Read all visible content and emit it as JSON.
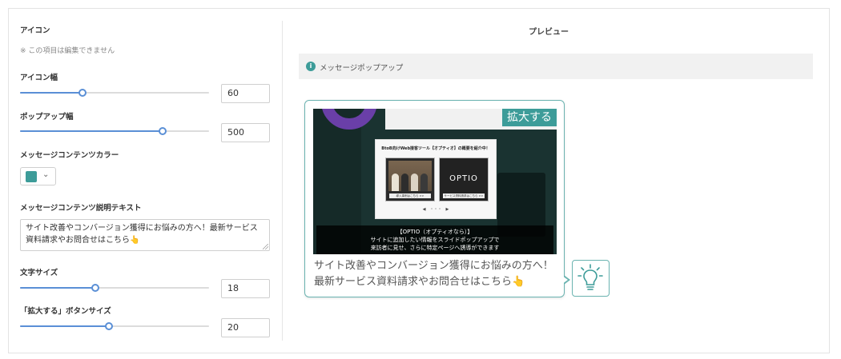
{
  "settings": {
    "icon_label": "アイコン",
    "icon_note": "※ この項目は編集できません",
    "icon_width": {
      "label": "アイコン幅",
      "value": "60",
      "fraction": 0.33
    },
    "popup_width": {
      "label": "ポップアップ幅",
      "value": "500",
      "fraction": 0.755
    },
    "content_color": {
      "label": "メッセージコンテンツカラー",
      "color": "#3d9c99"
    },
    "content_text": {
      "label": "メッセージコンテンツ説明テキスト",
      "value": "サイト改善やコンバージョン獲得にお悩みの方へ！最新サービス資料請求やお問合せはこちら👆"
    },
    "font_size": {
      "label": "文字サイズ",
      "value": "18",
      "fraction": 0.4
    },
    "expand_button_size": {
      "label": "「拡大する」ボタンサイズ",
      "value": "20",
      "fraction": 0.47
    }
  },
  "preview": {
    "title": "プレビュー",
    "tab_label": "メッセージポップアップ",
    "expand_label": "拡大する",
    "inner_title": "BtoB向けWeb接客ツール【オプティオ】の概要を紹介中！",
    "thumb_a_caption": "導入事例はこちら >>",
    "thumb_b_logo": "OPTIO",
    "thumb_b_caption": "サービス資料請求はこちら >>",
    "nav": "◀　・・・　▶",
    "caption_lines": [
      "【OPTIO（オプティオなら）】",
      "サイトに追加したい情報をスライドポップアップで",
      "来訪者に見せ、さらに特定ページへ誘導ができます"
    ],
    "message": "サイト改善やコンバージョン獲得にお悩みの方へ！最新サービス資料請求やお問合せはこちら👆"
  },
  "colors": {
    "accent": "#3d9c99",
    "slider": "#5a8fd6"
  }
}
